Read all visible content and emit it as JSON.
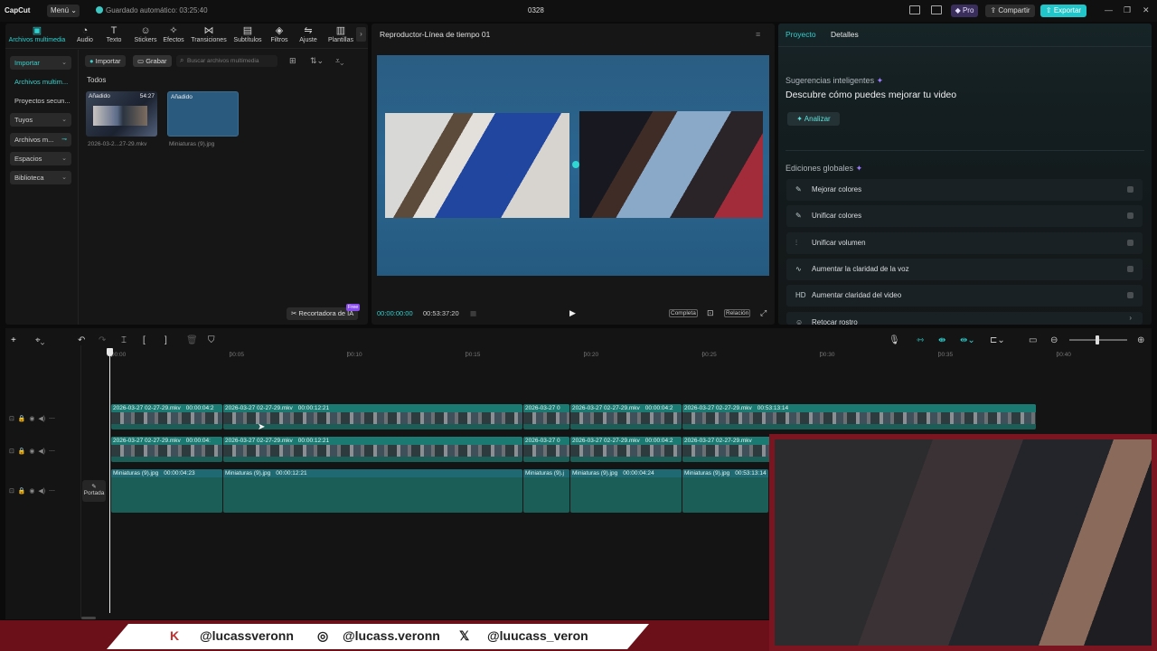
{
  "app": {
    "logo": "CapCut",
    "menu": "Menú",
    "autosave": "Guardado automático: 03:25:40",
    "project_title": "0328",
    "pro": "Pro",
    "share": "Compartir",
    "export": "Exportar"
  },
  "toolbar": [
    {
      "label": "Archivos multimedia",
      "icon": "media-icon"
    },
    {
      "label": "Audio",
      "icon": "audio-icon"
    },
    {
      "label": "Texto",
      "icon": "text-icon"
    },
    {
      "label": "Stickers",
      "icon": "sticker-icon"
    },
    {
      "label": "Efectos",
      "icon": "effects-icon"
    },
    {
      "label": "Transiciones",
      "icon": "transition-icon"
    },
    {
      "label": "Subtítulos",
      "icon": "subtitle-icon"
    },
    {
      "label": "Filtros",
      "icon": "filter-icon"
    },
    {
      "label": "Ajuste",
      "icon": "adjust-icon"
    },
    {
      "label": "Plantillas",
      "icon": "template-icon"
    }
  ],
  "sidebar": {
    "items": [
      "Importar",
      "Archivos multim...",
      "Proyectos secun...",
      "Tuyos",
      "Archivos m...",
      "Espacios",
      "Biblioteca"
    ]
  },
  "media": {
    "import": "Importar",
    "record": "Grabar",
    "search_placeholder": "Buscar archivos multimedia",
    "filter_label": "Todos",
    "items": [
      {
        "badge": "Añadido",
        "duration": "54:27",
        "name": "2026-03-2...27-29.mkv"
      },
      {
        "badge": "Añadido",
        "name": "Miniaturas (9).jpg"
      }
    ],
    "ai_cutter": "Recortadora de IA",
    "free": "Free"
  },
  "player": {
    "title": "Reproductor-Línea de tiempo 01",
    "current_time": "00:00:00:00",
    "total_time": "00:53:37:20",
    "complete": "Completa",
    "ratio": "Relación"
  },
  "right": {
    "tab_project": "Proyecto",
    "tab_details": "Detalles",
    "suggestions": "Sugerencias inteligentes",
    "suggestion_main": "Descubre cómo puedes mejorar tu video",
    "analyze": "Analizar",
    "global_edits": "Ediciones globales",
    "global_items": [
      {
        "icon": "✎",
        "label": "Mejorar colores"
      },
      {
        "icon": "✎",
        "label": "Unificar colores"
      },
      {
        "icon": "⫶",
        "label": "Unificar volumen"
      },
      {
        "icon": "∿",
        "label": "Aumentar la claridad de la voz"
      },
      {
        "icon": "HD",
        "label": "Aumentar claridad del video"
      },
      {
        "icon": "☺",
        "label": "Retocar rostro"
      }
    ]
  },
  "timeline": {
    "ruler": [
      "00:00",
      "00:05",
      "00:10",
      "00:15",
      "00:20",
      "00:25",
      "00:30",
      "00:35",
      "00:40"
    ],
    "cover": "Portada",
    "track1": [
      {
        "name": "2026-03-27 02-27-29.mkv",
        "dur": "00:00:04:2"
      },
      {
        "name": "2026-03-27 02-27-29.mkv",
        "dur": "00:00:12:21"
      },
      {
        "name": "2026-03-27 0",
        "dur": ""
      },
      {
        "name": "2026-03-27 02-27-29.mkv",
        "dur": "00:00:04:2"
      },
      {
        "name": "2026-03-27 02-27-29.mkv",
        "dur": "00:53:13:14"
      }
    ],
    "track2": [
      {
        "name": "2026-03-27 02-27-29.mkv",
        "dur": "00:00:04:"
      },
      {
        "name": "2026-03-27 02-27-29.mkv",
        "dur": "00:00:12:21"
      },
      {
        "name": "2026-03-27 0",
        "dur": ""
      },
      {
        "name": "2026-03-27 02-27-29.mkv",
        "dur": "00:00:04:2"
      },
      {
        "name": "2026-03-27 02-27-29.mkv",
        "dur": ""
      }
    ],
    "track3": [
      {
        "name": "Miniaturas (9).jpg",
        "dur": "00:00:04:23"
      },
      {
        "name": "Miniaturas (9).jpg",
        "dur": "00:00:12:21"
      },
      {
        "name": "Miniaturas (9).j",
        "dur": ""
      },
      {
        "name": "Miniaturas (9).jpg",
        "dur": "00:00:04:24"
      },
      {
        "name": "Miniaturas (9).jpg",
        "dur": "00:53:13:14"
      }
    ]
  },
  "social": {
    "kick": "@lucassveronn",
    "instagram": "@lucass.veronn",
    "x": "@luucass_veron"
  }
}
